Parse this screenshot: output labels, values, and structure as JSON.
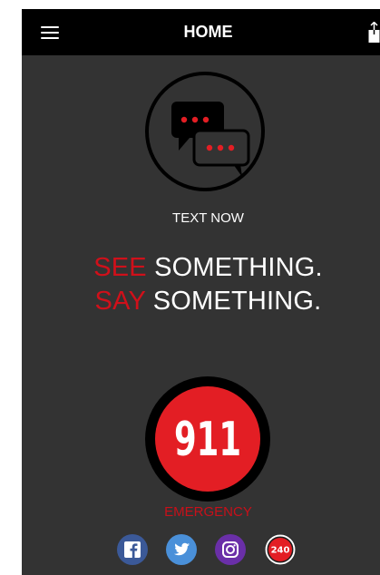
{
  "header": {
    "title": "HOME",
    "menu_icon": "hamburger-menu-icon",
    "share_icon": "share-icon"
  },
  "text_now": {
    "icon": "chat-bubbles-icon",
    "label": "TEXT NOW"
  },
  "slogan": {
    "line1_red": "SEE",
    "line1_white": " SOMETHING.",
    "line2_red": "SAY",
    "line2_white": " SOMETHING."
  },
  "emergency": {
    "number": "911",
    "label": "EMERGENCY"
  },
  "social": [
    {
      "icon": "facebook-icon",
      "text": "f",
      "color": "#3b5998"
    },
    {
      "icon": "twitter-icon",
      "text": "",
      "color": "#4a90d9"
    },
    {
      "icon": "instagram-icon",
      "text": "",
      "color": "#6a2fa8"
    },
    {
      "icon": "phone-240-icon",
      "text": "240",
      "color": "#c8101a"
    }
  ],
  "colors": {
    "background": "#333333",
    "header": "#000000",
    "accent_red": "#e31e24",
    "text": "#ffffff"
  }
}
